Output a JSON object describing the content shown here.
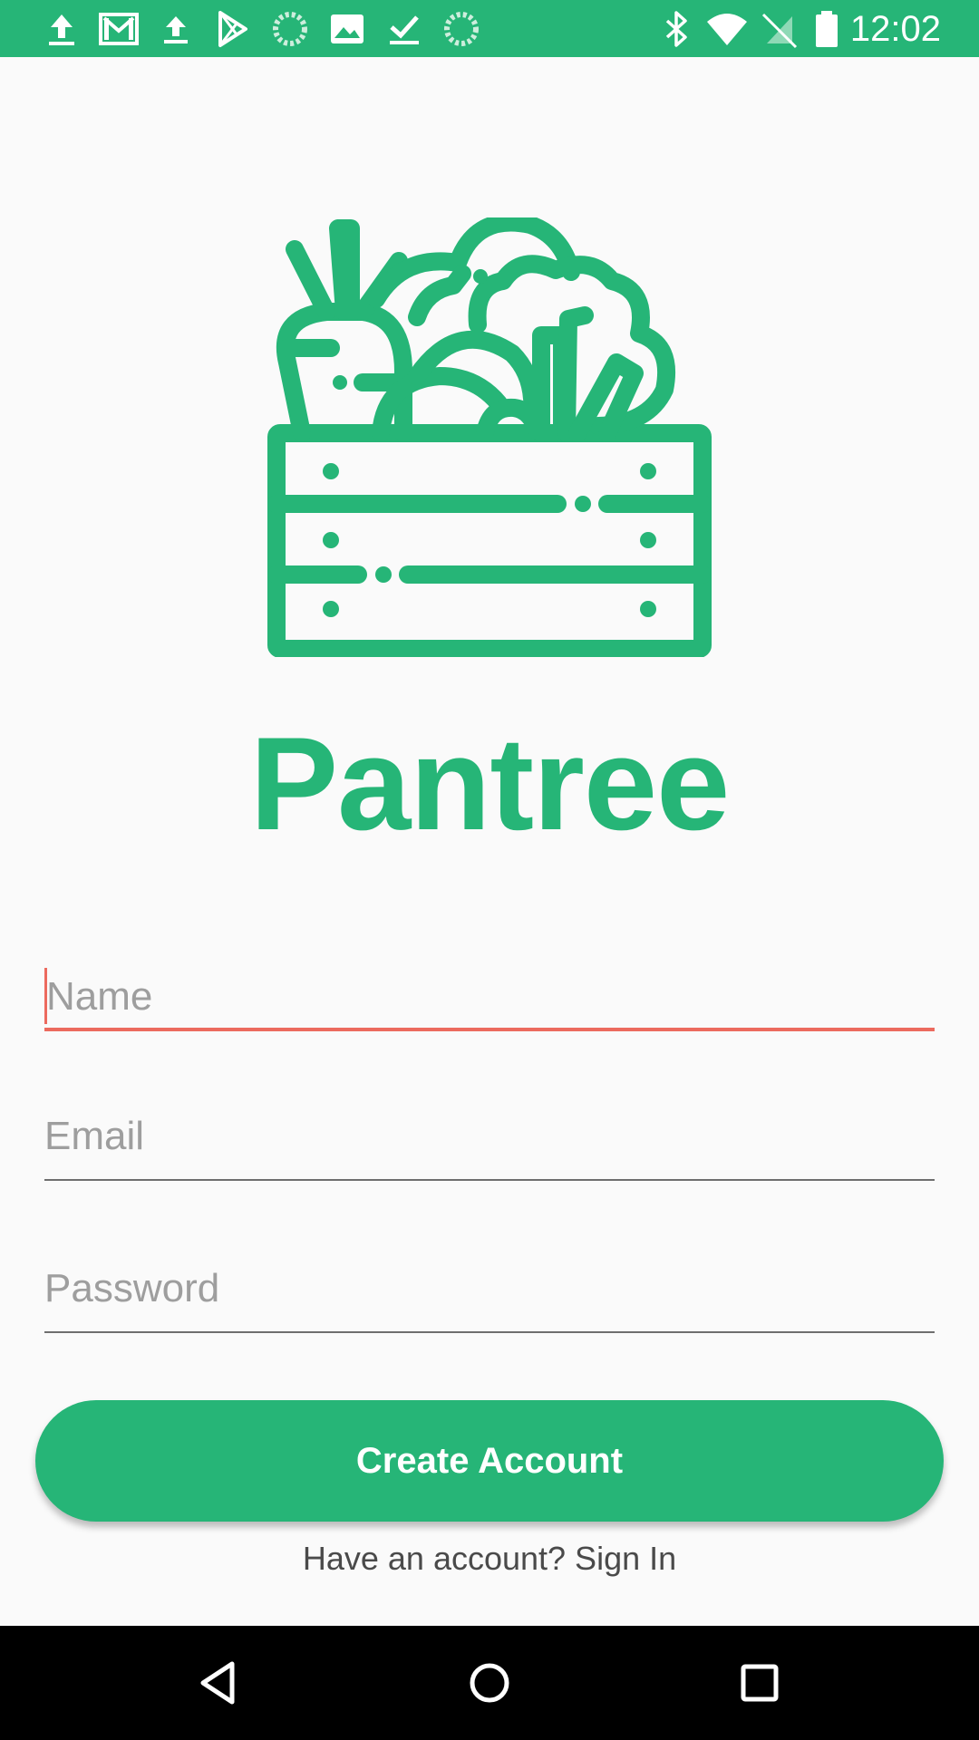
{
  "status_bar": {
    "time": "12:02",
    "background_color": "#26b577",
    "left_icons": [
      "upload-icon",
      "gmail-icon",
      "upload-icon",
      "play-store-icon",
      "loading-icon",
      "image-icon",
      "download-done-icon",
      "loading-icon"
    ],
    "right_icons": [
      "bluetooth-icon",
      "wifi-icon",
      "no-sim-icon",
      "battery-icon"
    ]
  },
  "app": {
    "name": "Pantree",
    "logo_icon": "vegetable-crate-icon",
    "brand_color": "#26b577"
  },
  "form": {
    "name_placeholder": "Name",
    "name_value": "",
    "email_placeholder": "Email",
    "email_value": "",
    "password_placeholder": "Password",
    "password_value": "",
    "focused_field_color": "#ec6a5e"
  },
  "actions": {
    "create_account_label": "Create Account",
    "sign_in_prompt": "Have an account? Sign In"
  },
  "nav_bar": {
    "buttons": [
      "back-icon",
      "home-icon",
      "recents-icon"
    ]
  }
}
